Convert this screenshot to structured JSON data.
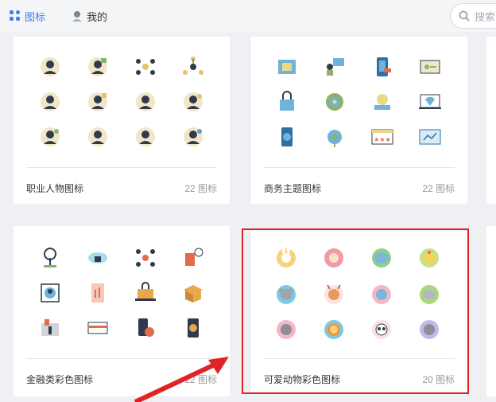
{
  "header": {
    "tab_icons": "图标",
    "tab_mine": "我的",
    "search_placeholder": "搜索"
  },
  "cards": [
    {
      "title": "职业人物图标",
      "count": "22 图标"
    },
    {
      "title": "商务主题图标",
      "count": "22 图标"
    },
    {
      "title": "金融类彩色图标",
      "count": "22 图标"
    },
    {
      "title": "可爱动物彩色图标",
      "count": "20 图标"
    }
  ],
  "colors": {
    "accent": "#3d7ff0",
    "highlight_border": "#e02424",
    "arrow": "#e02424"
  }
}
